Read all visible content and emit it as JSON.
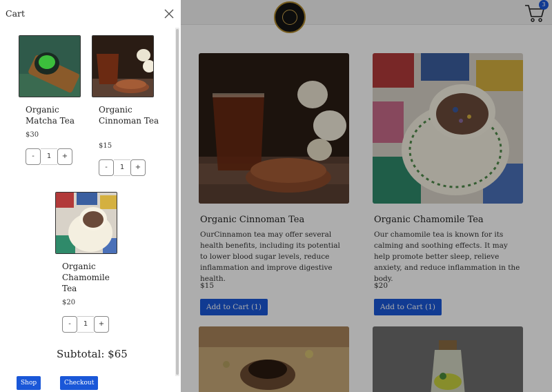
{
  "header": {
    "logo_icon": "tea-house-logo",
    "cart_icon": "cart-icon",
    "cart_count": "3",
    "accent_color": "#1a57d8"
  },
  "products": [
    {
      "title": "Organic Cinnoman Tea",
      "description": "OurCinnamon tea may offer several health benefits, including its potential to lower blood sugar levels, reduce inflammation and improve digestive health.",
      "price": "$15",
      "button_label": "Add to Cart (1)"
    },
    {
      "title": "Organic Chamomile Tea",
      "description": "Our chamomile tea is known for its calming and soothing effects. It may help promote better sleep, relieve anxiety, and reduce inflammation in the body.",
      "price": "$20",
      "button_label": "Add to Cart (1)"
    }
  ],
  "cart": {
    "title": "Cart",
    "close_icon": "close-icon",
    "items": [
      {
        "name": "Organic Matcha Tea",
        "price": "$30",
        "minus": "-",
        "quantity": "1",
        "plus": "+"
      },
      {
        "name": "Organic Cinnoman Tea",
        "price": "$15",
        "minus": "-",
        "quantity": "1",
        "plus": "+"
      },
      {
        "name": "Organic Chamomile Tea",
        "price": "$20",
        "minus": "-",
        "quantity": "1",
        "plus": "+"
      }
    ],
    "subtotal": "Subtotal: $65",
    "shop_label": "Shop",
    "checkout_label": "Checkout"
  }
}
